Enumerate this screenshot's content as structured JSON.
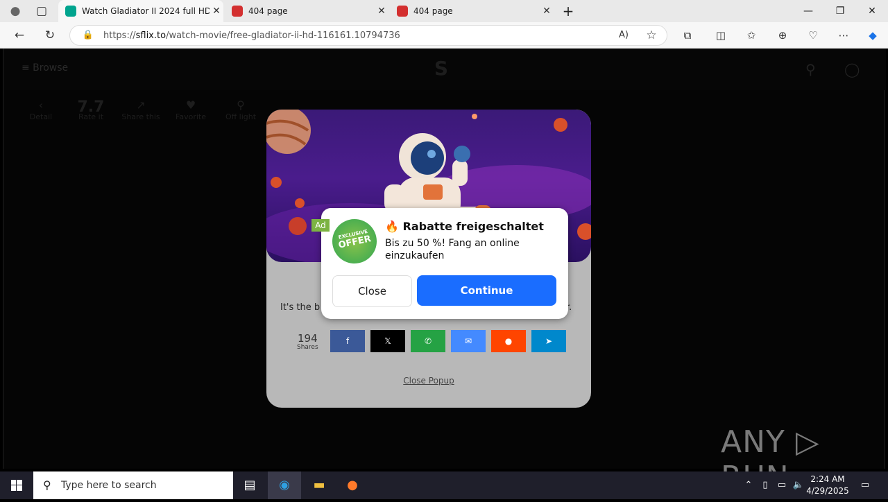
{
  "browser": {
    "tabs": [
      {
        "title": "Watch Gladiator II 2024 full HD o",
        "active": true
      },
      {
        "title": "404 page",
        "active": false
      },
      {
        "title": "404 page",
        "active": false
      }
    ],
    "url_prefix": "https://",
    "url_domain": "sflix.to",
    "url_path": "/watch-movie/free-gladiator-ii-hd-116161.10794736"
  },
  "site": {
    "browse": "≡  Browse",
    "actions": [
      {
        "icon": "‹",
        "label": "Detail"
      },
      {
        "icon": "7.7",
        "label": "Rate it"
      },
      {
        "icon": "↗",
        "label": "Share this"
      },
      {
        "icon": "♥",
        "label": "Favorite"
      },
      {
        "icon": "⚲",
        "label": "Off light"
      }
    ]
  },
  "share_popup": {
    "text_start": "It's the b",
    "text_end": "er.",
    "count": "194",
    "count_label": "Shares",
    "buttons": [
      {
        "name": "facebook",
        "glyph": "f",
        "color": "#3b5998"
      },
      {
        "name": "x",
        "glyph": "𝕏",
        "color": "#000000"
      },
      {
        "name": "whatsapp",
        "glyph": "✆",
        "color": "#25a244"
      },
      {
        "name": "messenger",
        "glyph": "✉",
        "color": "#448aff"
      },
      {
        "name": "reddit",
        "glyph": "●",
        "color": "#ff4500"
      },
      {
        "name": "telegram",
        "glyph": "➤",
        "color": "#0088cc"
      }
    ],
    "close_link": "Close Popup"
  },
  "ad": {
    "badge": "Ad",
    "seal_top": "EXCLUSIVE",
    "seal_main": "OFFER",
    "title": "🔥 Rabatte freigeschaltet",
    "body": "Bis zu 50 %! Fang an online einzukaufen",
    "close_label": "Close",
    "continue_label": "Continue"
  },
  "watermark": "ANY ▷ RUN",
  "taskbar": {
    "search_placeholder": "Type here to search",
    "time": "2:24 AM",
    "date": "4/29/2025"
  }
}
